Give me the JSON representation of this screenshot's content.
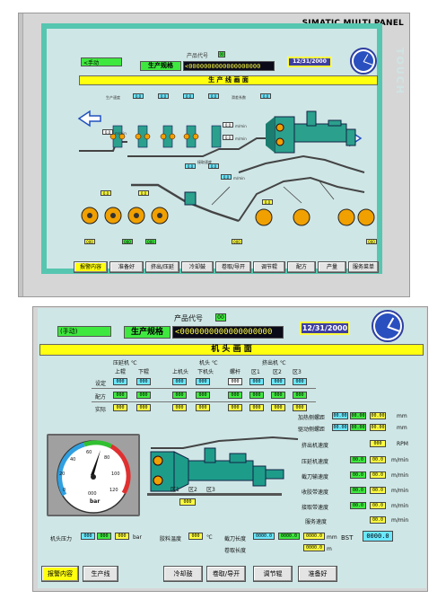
{
  "top": {
    "brand": "SIMATIC MULTI PANEL",
    "touch": "TOUCH",
    "mode": "<手动",
    "product_code_label": "产品代号",
    "product_code_value": "00",
    "spec_label": "生产规格",
    "spec_value": "<0000000000000000000",
    "date": "12/31/2000",
    "screen_title": "生 产 线 画 面",
    "unit_mmin": "m/min",
    "small_values": [
      "0.0",
      "0.0",
      "0.0",
      "0.0",
      "0.0",
      "0.0",
      "000",
      "000",
      "000",
      "000",
      "000"
    ],
    "buttons": [
      {
        "label": "报警内容",
        "active": true
      },
      {
        "label": "准备好",
        "active": false
      },
      {
        "label": "挤出/压延",
        "active": false
      },
      {
        "label": "冷却鼓",
        "active": false
      },
      {
        "label": "卷取/导开",
        "active": false
      },
      {
        "label": "调节辊",
        "active": false
      },
      {
        "label": "配方",
        "active": false
      },
      {
        "label": "产量",
        "active": false
      },
      {
        "label": "服务菜单",
        "active": false
      }
    ]
  },
  "bottom": {
    "mode": "(手动)",
    "product_code_label": "产品代号",
    "product_code_value": "00",
    "spec_label": "生产规格",
    "spec_value": "<0000000000000000000",
    "date": "12/31/2000",
    "screen_title": "机 头 画 面",
    "groups": {
      "calender": "压延机 ℃",
      "head": "机头 ℃",
      "extruder": "挤出机 ℃"
    },
    "col_headers": [
      "上辊",
      "下辊",
      "上机头",
      "下机头",
      "螺杆",
      "区1",
      "区2",
      "区3"
    ],
    "row_labels": [
      "设定",
      "配方",
      "实际"
    ],
    "rows": {
      "set": [
        "000",
        "000",
        "000",
        "000",
        "000",
        "000",
        "000",
        "000"
      ],
      "recipe": [
        "000",
        "000",
        "000",
        "000",
        "000",
        "000",
        "000",
        "000"
      ],
      "actual": [
        "000",
        "000",
        "000",
        "000",
        "000",
        "000",
        "000",
        "000"
      ]
    },
    "right_params": [
      {
        "label": "加热侧螺距",
        "values": [
          "00.00",
          "00.00",
          "00.00"
        ],
        "unit": "mm"
      },
      {
        "label": "驱动侧螺距",
        "values": [
          "00.00",
          "00.00",
          "00.00"
        ],
        "unit": "mm"
      },
      {
        "label": "挤出机速度",
        "values": [
          "000"
        ],
        "unit": "RPM"
      },
      {
        "label": "压延机速度",
        "values": [
          "00.0",
          "00.0"
        ],
        "unit": "m/min"
      },
      {
        "label": "截刀输速度",
        "values": [
          "00.0",
          "00.0"
        ],
        "unit": "m/min"
      },
      {
        "label": "收胶带速度",
        "values": [
          "00.0",
          "00.0"
        ],
        "unit": "m/min"
      },
      {
        "label": "接取带速度",
        "values": [
          "00.0",
          "00.0"
        ],
        "unit": "m/min"
      },
      {
        "label": "服务速度",
        "values": [
          "00.0"
        ],
        "unit": "m/min"
      }
    ],
    "gauge": {
      "ticks": [
        "0",
        "20",
        "40",
        "60",
        "80",
        "100",
        "120"
      ],
      "unit": "bar",
      "readout": "000",
      "value": 0
    },
    "zones": [
      "区1",
      "区2",
      "区3"
    ],
    "zone_value": "000",
    "head_pressure_label": "机头压力",
    "head_pressure_values": [
      "000",
      "000",
      "000"
    ],
    "head_pressure_unit": "bar",
    "glue_temp_label": "胶料温度",
    "glue_temp_value": "000",
    "glue_temp_unit": "℃",
    "cut_length_label": "截刀长度",
    "cut_length_values": [
      "0000.0",
      "0000.0",
      "0000.0"
    ],
    "cut_length_unit": "mm",
    "roll_length_label": "卷取长度",
    "roll_length_value": "0000.0",
    "roll_length_unit": "m",
    "bst_label": "BST",
    "bst_value": "0000.0",
    "buttons": [
      {
        "label": "报警内容",
        "active": true
      },
      {
        "label": "生产线",
        "active": false
      },
      {
        "label": "冷却鼓",
        "active": false
      },
      {
        "label": "卷取/导开",
        "active": false
      },
      {
        "label": "调节辊",
        "active": false
      },
      {
        "label": "准备好",
        "active": false
      }
    ]
  },
  "colors": {
    "screen_bg": "#cfe6e6",
    "title_yellow": "#ffff10",
    "field_green": "#3fe83f",
    "field_cyan": "#6be8ff",
    "machine_teal": "#1e9c8a",
    "frame_teal": "#56c6b0"
  }
}
